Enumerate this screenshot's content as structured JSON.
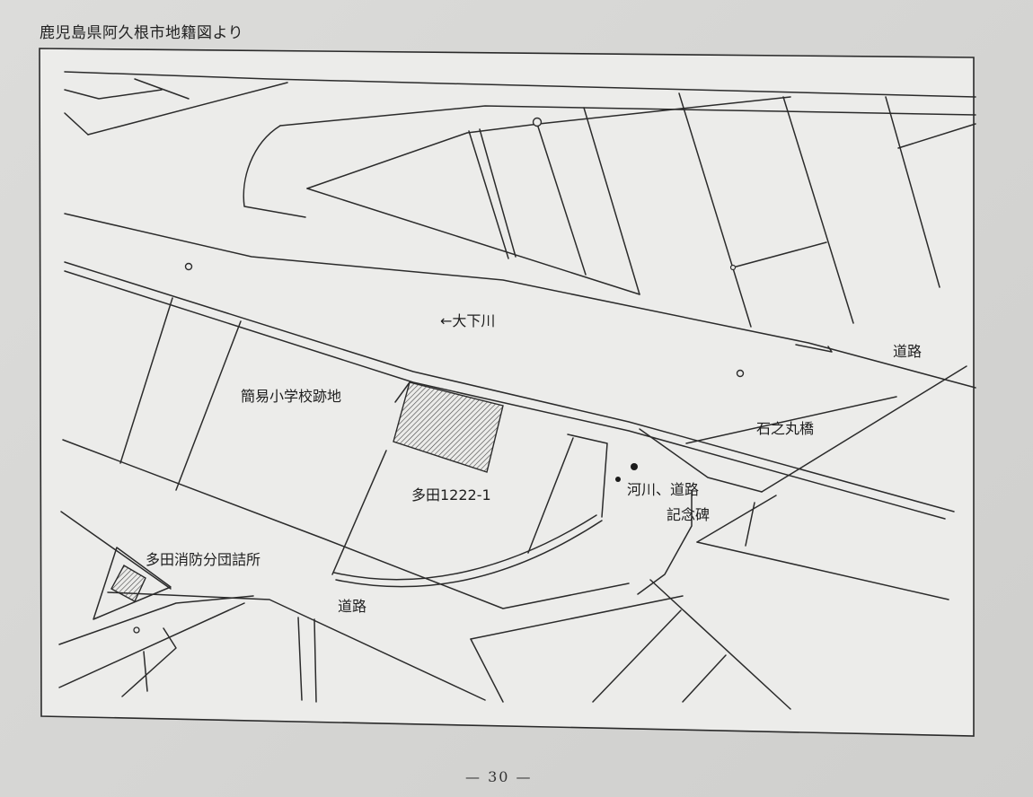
{
  "caption": "鹿児島県阿久根市地籍図より",
  "labels": {
    "river": "←大下川",
    "road_east": "道路",
    "school_site": "簡易小学校跡地",
    "bridge": "石之丸橋",
    "parcel": "多田1222-1",
    "monument_line1": "河川、道路",
    "monument_line2": "記念碑",
    "fire_station": "多田消防分団詰所",
    "road_south": "道路"
  },
  "page_number": "— 30 —"
}
